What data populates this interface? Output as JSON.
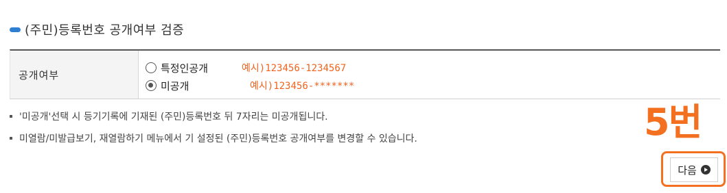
{
  "section": {
    "title": "(주민)등록번호 공개여부 검증"
  },
  "form": {
    "label": "공개여부",
    "options": [
      {
        "label": "특정인공개",
        "example": "예시)123456-1234567",
        "selected": false
      },
      {
        "label": "미공개",
        "example": "예시)123456-*******",
        "selected": true
      }
    ]
  },
  "notes": [
    "'미공개'선택 시 등기기록에 기재된 (주민)등록번호 뒤 7자리는 미공개됩니다.",
    "미열람/미발급보기, 재열람하기 메뉴에서 기 설정된 (주민)등록번호 공개여부를 변경할 수 있습니다."
  ],
  "annotation": {
    "step_label": "5번",
    "color": "#f27020"
  },
  "actions": {
    "next_label": "다음"
  }
}
